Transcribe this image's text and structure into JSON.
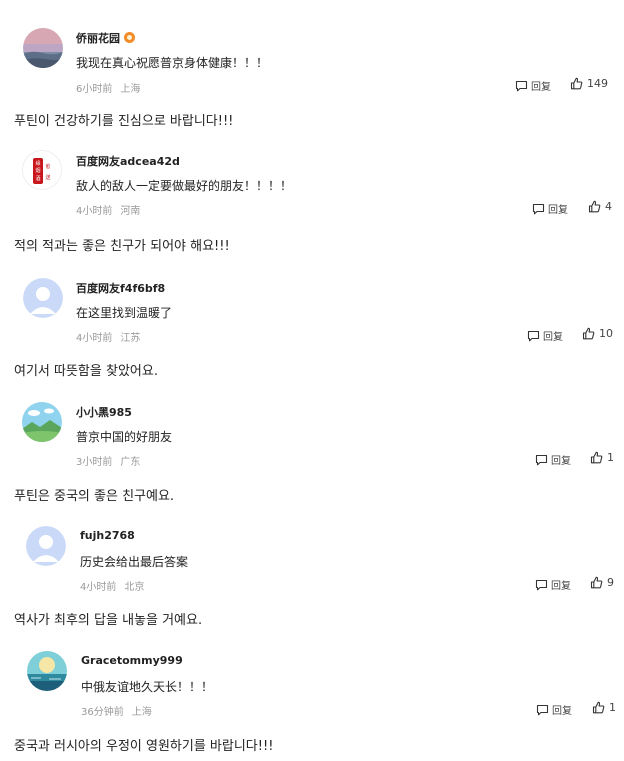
{
  "reply_label": "回复",
  "comments": [
    {
      "username": "侨丽花园",
      "has_badge": true,
      "text": "我现在真心祝愿普京身体健康！！！",
      "time": "6小时前",
      "location": "上海",
      "likes": "149",
      "translation": "푸틴이 건강하기를 진심으로 바랍니다!!!"
    },
    {
      "username": "百度网友adcea42d",
      "text": "敌人的敌人一定要做最好的朋友！！！！",
      "time": "4小时前",
      "location": "河南",
      "likes": "4",
      "translation": "적의 적과는 좋은 친구가 되어야 해요!!!",
      "avatar_seal_text": [
        "缘",
        "烟",
        "愈",
        "酒",
        "送"
      ]
    },
    {
      "username": "百度网友f4f6bf8",
      "text": "在这里找到温暖了",
      "time": "4小时前",
      "location": "江苏",
      "likes": "10",
      "translation": "여기서 따뜻함을 찾았어요."
    },
    {
      "username": "小小黑985",
      "text": "普京中国的好朋友",
      "time": "3小时前",
      "location": "广东",
      "likes": "1",
      "translation": "푸틴은 중국의 좋은 친구예요."
    },
    {
      "username": "fujh2768",
      "text": "历史会给出最后答案",
      "time": "4小时前",
      "location": "北京",
      "likes": "9",
      "translation": "역사가 최후의 답을 내놓을 거예요."
    },
    {
      "username": "Gracetommy999",
      "text": "中俄友谊地久天长！！！",
      "time": "36分钟前",
      "location": "上海",
      "likes": "1",
      "translation": "중국과 러시아의 우정이 영원하기를 바랍니다!!!"
    }
  ],
  "colors": {
    "username": "#222222",
    "meta": "#999999",
    "seal_red": "#c8161d",
    "default_avatar": "#c9d9f7"
  }
}
